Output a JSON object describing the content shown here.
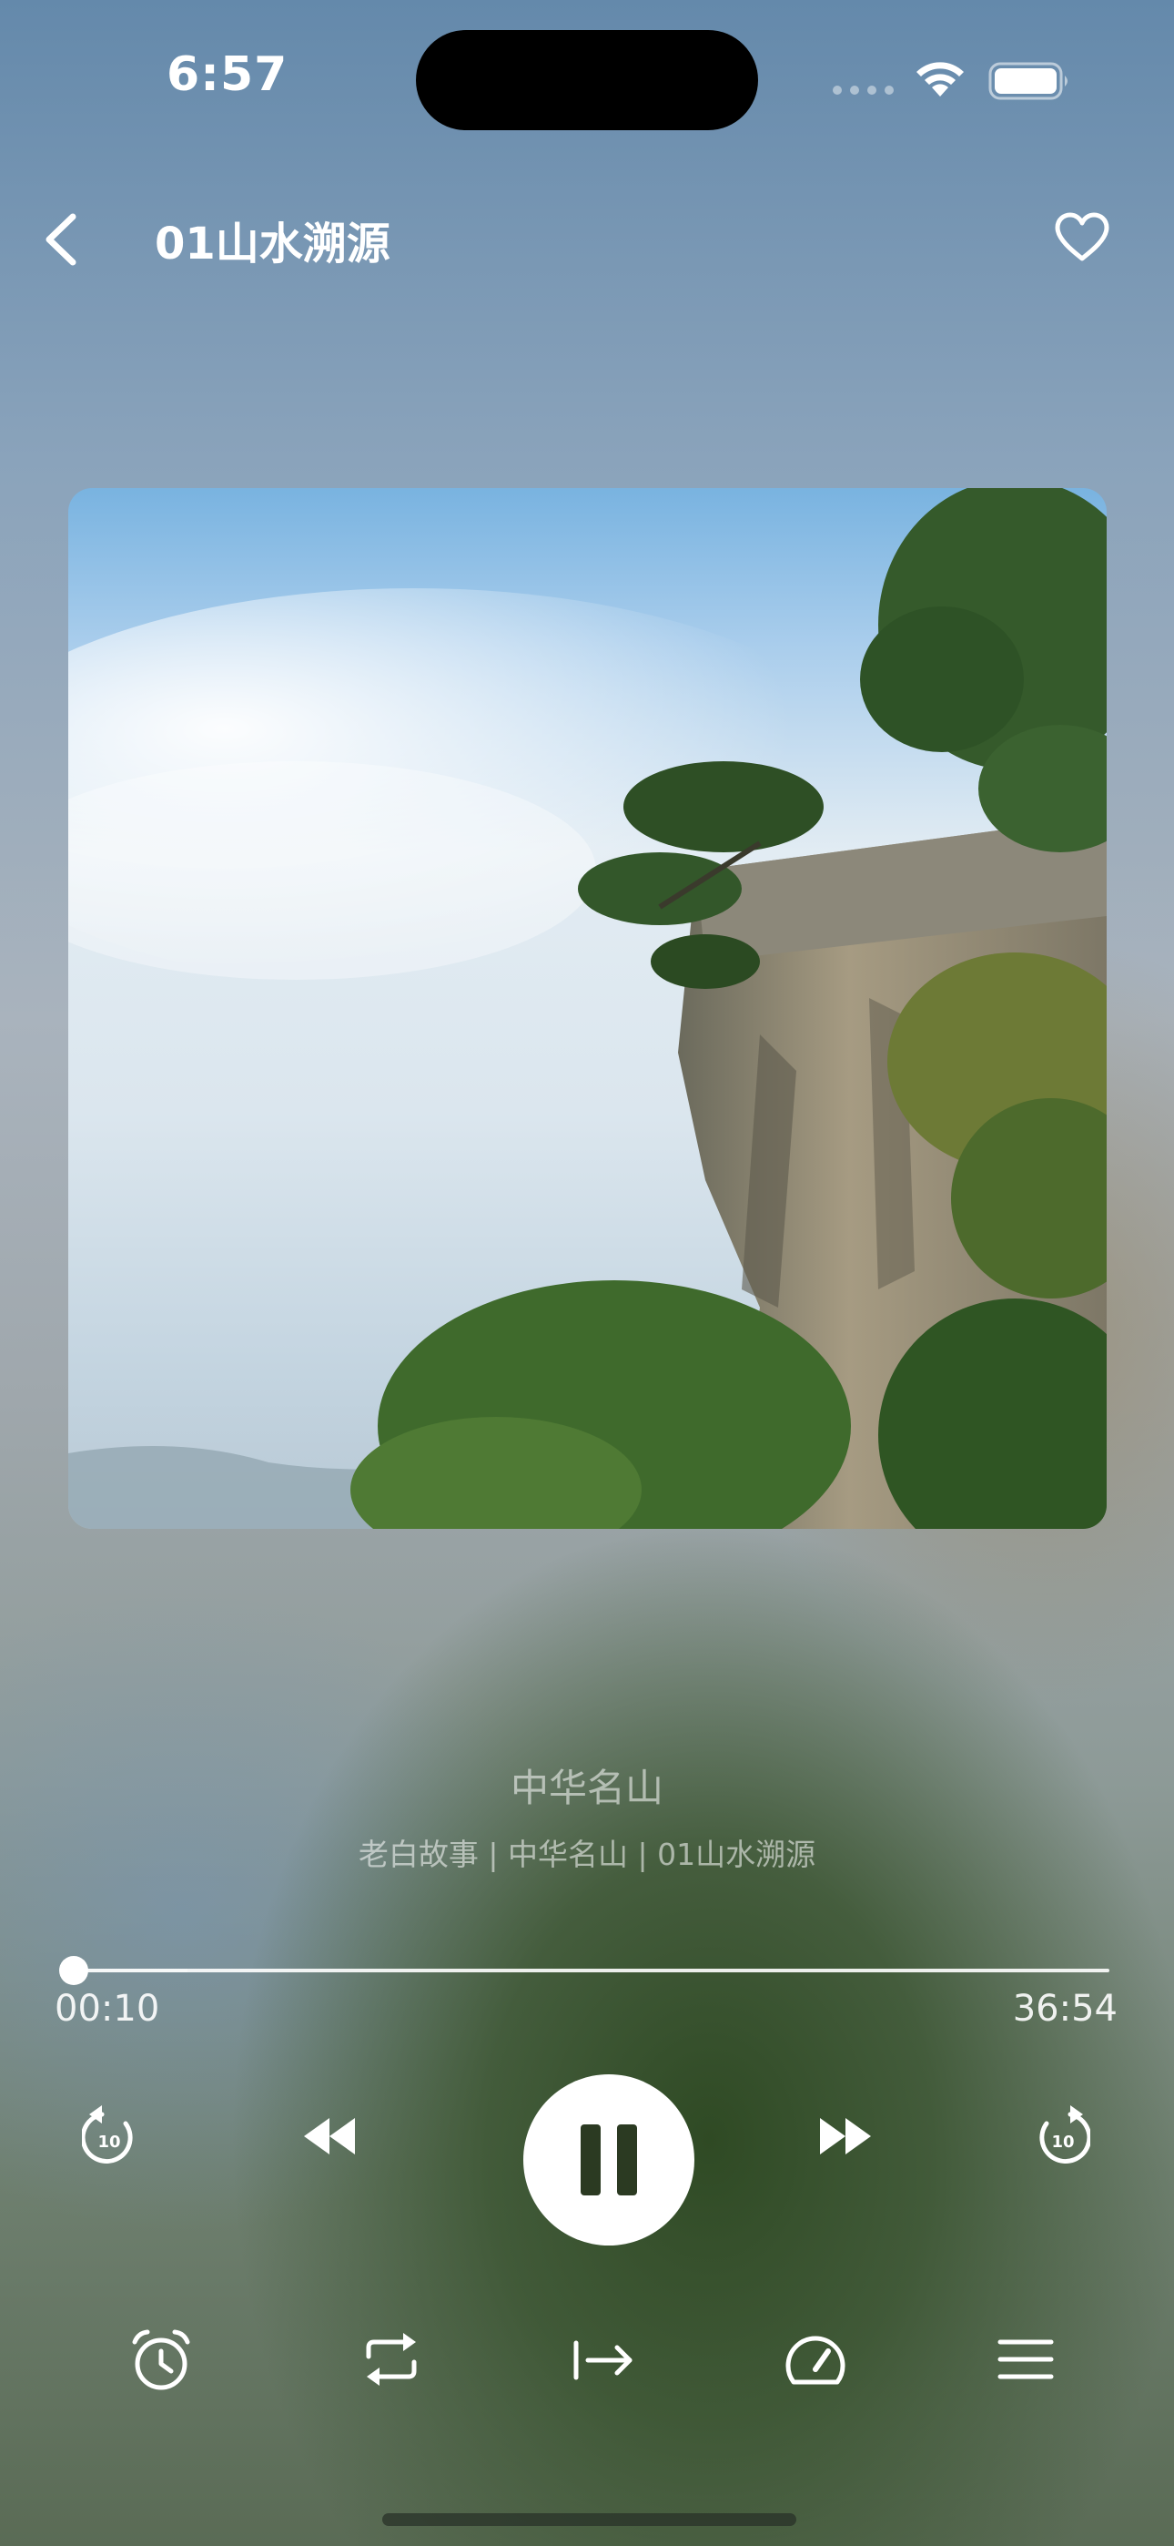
{
  "status_bar": {
    "time": "6:57"
  },
  "nav": {
    "title": "01山水溯源",
    "back_icon": "chevron-left-icon",
    "favorite_icon": "heart-icon"
  },
  "track": {
    "title": "中华名山",
    "subtitle": "老白故事 | 中华名山 | 01山水溯源"
  },
  "progress": {
    "elapsed": "00:10",
    "total": "36:54",
    "fraction": 0.0045
  },
  "controls": {
    "rewind_10_label": "10",
    "forward_10_label": "10",
    "icons": [
      "rewind-10-icon",
      "previous-icon",
      "pause-icon",
      "next-icon",
      "forward-10-icon"
    ]
  },
  "bottom_toolbar": {
    "icons": [
      "alarm-clock-icon",
      "repeat-icon",
      "play-next-icon",
      "speed-icon",
      "playlist-icon"
    ]
  },
  "colors": {
    "pause_glyph": "#2b3a22",
    "accent": "#ffffff"
  }
}
